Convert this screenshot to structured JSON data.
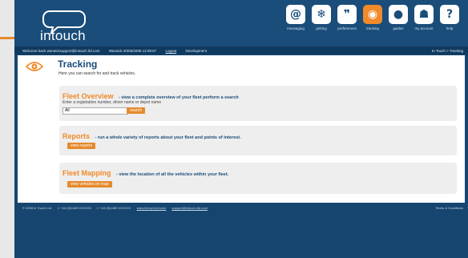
{
  "brand": {
    "logo_text": "intouch"
  },
  "nav": [
    {
      "label": "messaging",
      "icon": "at-icon",
      "glyph": "@"
    },
    {
      "label": "gritting",
      "icon": "snowflake-icon",
      "glyph": "❄"
    },
    {
      "label": "preferences",
      "icon": "quote-icon",
      "glyph": "❞"
    },
    {
      "label": "tracking",
      "icon": "eye-icon",
      "glyph": "◉",
      "active": true
    },
    {
      "label": "guides",
      "icon": "drop-icon",
      "glyph": "●"
    },
    {
      "label": "my account",
      "icon": "user-icon",
      "glyph": "☗"
    },
    {
      "label": "help",
      "icon": "question-icon",
      "glyph": "?"
    }
  ],
  "status": {
    "welcome": "Welcome back warwicksupport@intouch ltd.com",
    "datetime": "Warwick 20/06/2008 13:39:57",
    "logout": "Logout",
    "development": "Development",
    "breadcrumb": "In Touch > Tracking"
  },
  "page": {
    "title": "Tracking",
    "subtitle": "Here you can search for and track vehicles."
  },
  "sections": {
    "overview": {
      "title": "Fleet Overview",
      "desc": "- view a complete overview of your fleet perform a search",
      "hint": "Enter a registration number, driver name or depot name",
      "input_value": "All",
      "button": "search"
    },
    "reports": {
      "title": "Reports",
      "desc": "- run a whole variety of reports about your fleet and points of interest.",
      "button": "view reports"
    },
    "mapping": {
      "title": "Fleet Mapping",
      "desc": "- view the location of all the vehicles within your fleet.",
      "button": "view vehicles on map"
    }
  },
  "footer": {
    "copyright": "© 2008 In Touch Ltd.",
    "phone": "t: +44 (0)1489 XXXXXX",
    "fax": "f: +44 (0)1489 XXXXXX",
    "web": "www.intouch-ltd.com",
    "email": "support@intouch-ltd.com",
    "terms": "Terms & Conditions"
  },
  "colors": {
    "accent": "#f08a2a",
    "brand": "#1a4d7a"
  }
}
